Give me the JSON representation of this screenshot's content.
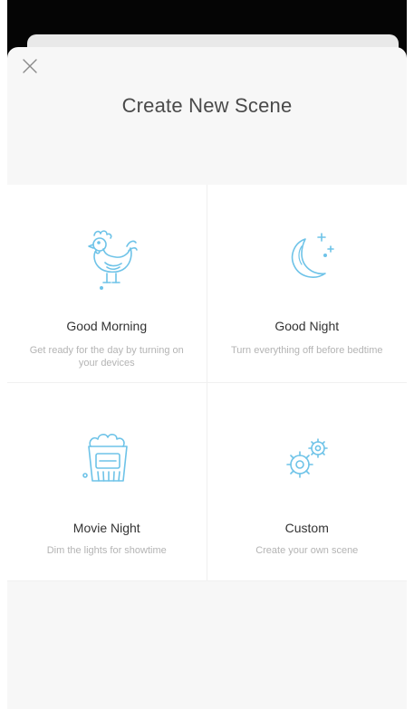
{
  "header": {
    "title": "Create New Scene",
    "close_icon": "close-icon"
  },
  "colors": {
    "icon_accent": "#6ec3e8",
    "title_text": "#4a4a4a",
    "tile_title": "#333333",
    "tile_desc": "#b4b4b4"
  },
  "scenes": [
    {
      "title": "Good Morning",
      "description": "Get ready for the day by turning on your devices",
      "icon": "rooster-icon"
    },
    {
      "title": "Good Night",
      "description": "Turn everything off before bedtime",
      "icon": "moon-stars-icon"
    },
    {
      "title": "Movie Night",
      "description": "Dim the lights for showtime",
      "icon": "popcorn-icon"
    },
    {
      "title": "Custom",
      "description": "Create your own scene",
      "icon": "gears-icon"
    }
  ]
}
